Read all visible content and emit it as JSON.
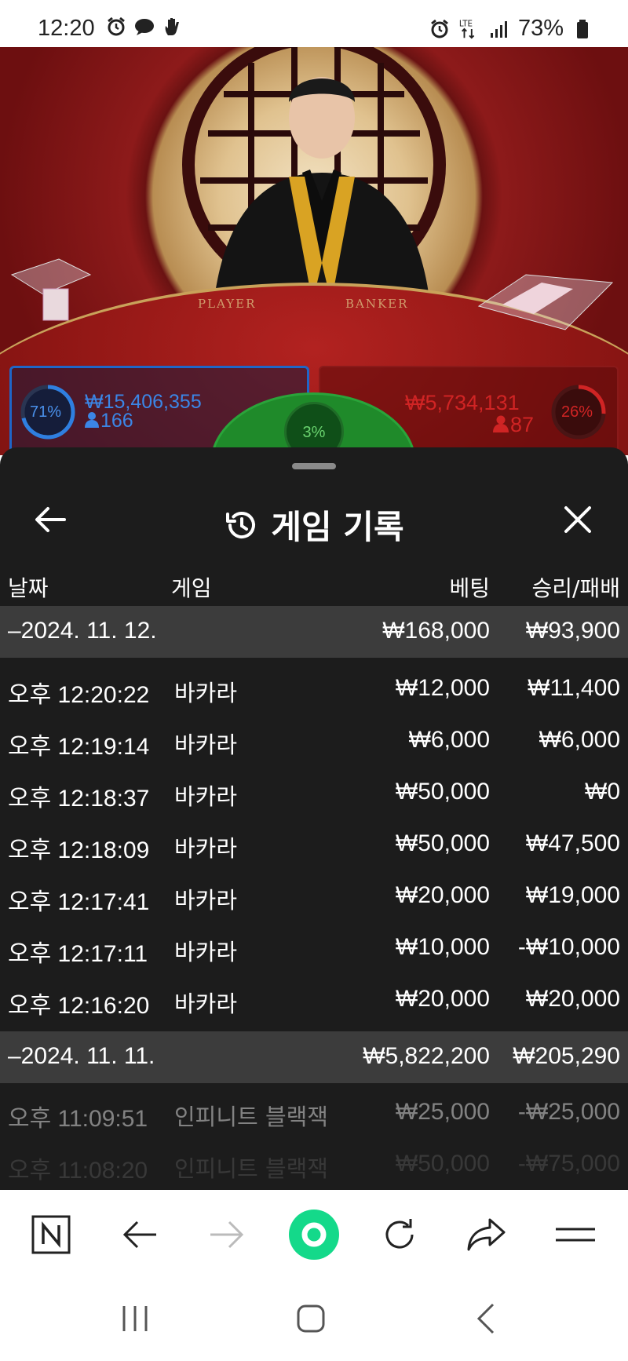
{
  "status_bar": {
    "time": "12:20",
    "network": "LTE",
    "battery": "73%",
    "left_icons": [
      "alarm-icon",
      "chat-icon",
      "hand-icon"
    ],
    "right_icons": [
      "alarm-icon",
      "lte-icon",
      "signal-icon",
      "battery-icon"
    ]
  },
  "game_stream": {
    "player_label": "PLAYER",
    "banker_label": "BANKER",
    "player": {
      "percent": "71%",
      "amount": "₩15,406,355",
      "count": "166",
      "fill": 0.71,
      "color": "#1e66c8"
    },
    "banker": {
      "percent": "26%",
      "amount": "₩5,734,131",
      "count": "87",
      "fill": 0.26,
      "color": "#d02424"
    },
    "tie": {
      "percent": "3%",
      "fill": 0.03,
      "color": "#2aa43a"
    }
  },
  "history": {
    "title": "게임 기록",
    "columns": {
      "date": "날짜",
      "game": "게임",
      "bet": "베팅",
      "result": "승리/패배"
    },
    "groups": [
      {
        "date": "–2024. 11. 12.",
        "bet_total": "₩168,000",
        "result_total": "₩93,900",
        "rows": [
          {
            "time": "오후 12:20:22",
            "game": "바카라",
            "bet": "₩12,000",
            "result": "₩11,400"
          },
          {
            "time": "오후 12:19:14",
            "game": "바카라",
            "bet": "₩6,000",
            "result": "₩6,000"
          },
          {
            "time": "오후 12:18:37",
            "game": "바카라",
            "bet": "₩50,000",
            "result": "₩0"
          },
          {
            "time": "오후 12:18:09",
            "game": "바카라",
            "bet": "₩50,000",
            "result": "₩47,500"
          },
          {
            "time": "오후 12:17:41",
            "game": "바카라",
            "bet": "₩20,000",
            "result": "₩19,000"
          },
          {
            "time": "오후 12:17:11",
            "game": "바카라",
            "bet": "₩10,000",
            "result": "-₩10,000"
          },
          {
            "time": "오후 12:16:20",
            "game": "바카라",
            "bet": "₩20,000",
            "result": "₩20,000"
          }
        ]
      },
      {
        "date": "–2024. 11. 11.",
        "bet_total": "₩5,822,200",
        "result_total": "₩205,290",
        "rows": [
          {
            "time": "오후 11:09:51",
            "game": "인피니트 블랙잭",
            "bet": "₩25,000",
            "result": "-₩25,000"
          },
          {
            "time": "오후 11:08:20",
            "game": "인피니트 블랙잭",
            "bet": "₩50,000",
            "result": "-₩75,000"
          }
        ]
      }
    ]
  },
  "browser_toolbar": {
    "items": [
      "naver-home-icon",
      "back-arrow-icon",
      "forward-arrow-icon",
      "green-dot-icon",
      "refresh-icon",
      "share-icon",
      "menu-icon"
    ]
  },
  "system_nav": {
    "items": [
      "recent-apps-icon",
      "home-icon",
      "back-icon"
    ]
  }
}
